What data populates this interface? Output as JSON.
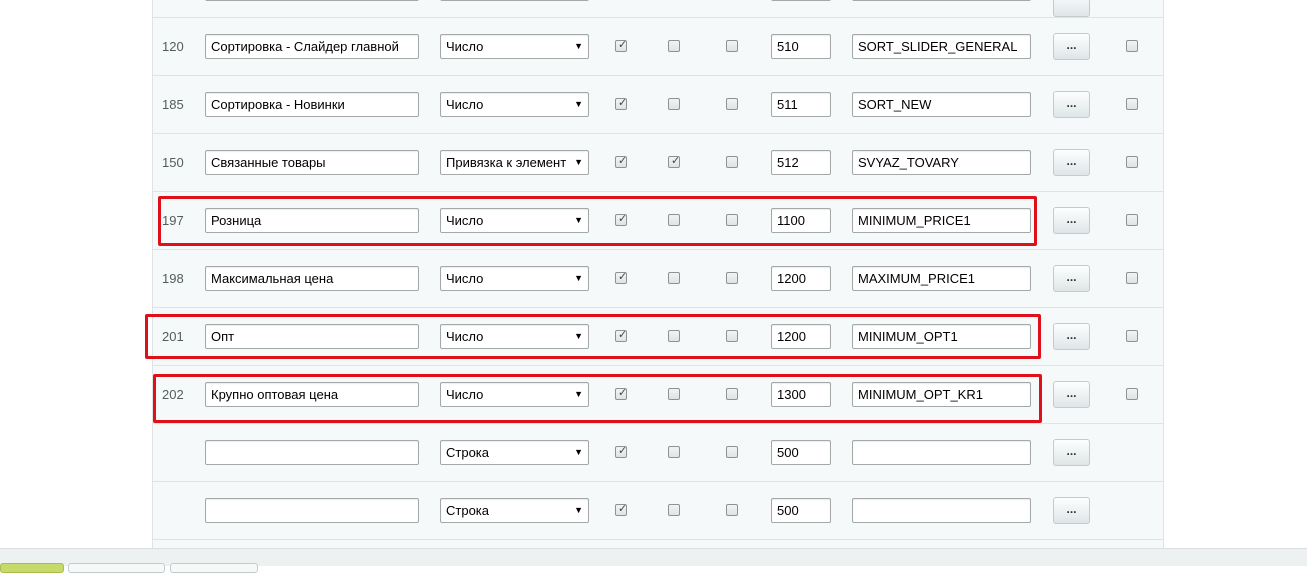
{
  "rows": [
    {
      "id": "120",
      "name": "Сортировка - Слайдер главной",
      "type": "Число",
      "c1": true,
      "c2": false,
      "c3": false,
      "sort": "510",
      "code": "SORT_SLIDER_GENERAL",
      "more": "...",
      "c4": false
    },
    {
      "id": "185",
      "name": "Сортировка - Новинки",
      "type": "Число",
      "c1": true,
      "c2": false,
      "c3": false,
      "sort": "511",
      "code": "SORT_NEW",
      "more": "...",
      "c4": false
    },
    {
      "id": "150",
      "name": "Связанные товары",
      "type": "Привязка к элемент",
      "c1": true,
      "c2": true,
      "c3": false,
      "sort": "512",
      "code": "SVYAZ_TOVARY",
      "more": "...",
      "c4": false
    },
    {
      "id": "197",
      "name": "Розница",
      "type": "Число",
      "c1": true,
      "c2": false,
      "c3": false,
      "sort": "1100",
      "code": "MINIMUM_PRICE1",
      "more": "...",
      "c4": false
    },
    {
      "id": "198",
      "name": "Максимальная цена",
      "type": "Число",
      "c1": true,
      "c2": false,
      "c3": false,
      "sort": "1200",
      "code": "MAXIMUM_PRICE1",
      "more": "...",
      "c4": false
    },
    {
      "id": "201",
      "name": "Опт",
      "type": "Число",
      "c1": true,
      "c2": false,
      "c3": false,
      "sort": "1200",
      "code": "MINIMUM_OPT1",
      "more": "...",
      "c4": false
    },
    {
      "id": "202",
      "name": "Крупно оптовая цена",
      "type": "Число",
      "c1": true,
      "c2": false,
      "c3": false,
      "sort": "1300",
      "code": "MINIMUM_OPT_KR1",
      "more": "...",
      "c4": false
    },
    {
      "id": "",
      "name": "",
      "type": "Строка",
      "c1": true,
      "c2": false,
      "c3": false,
      "sort": "500",
      "code": "",
      "more": "...",
      "c4": null
    },
    {
      "id": "",
      "name": "",
      "type": "Строка",
      "c1": true,
      "c2": false,
      "c3": false,
      "sort": "500",
      "code": "",
      "more": "...",
      "c4": null
    }
  ],
  "colors": {
    "highlight": "#e0101b",
    "panel_bg": "#f5f9f9",
    "border": "#dfe3e3"
  },
  "icons": {
    "check": "check-icon",
    "caret": "chevron-down-icon"
  }
}
